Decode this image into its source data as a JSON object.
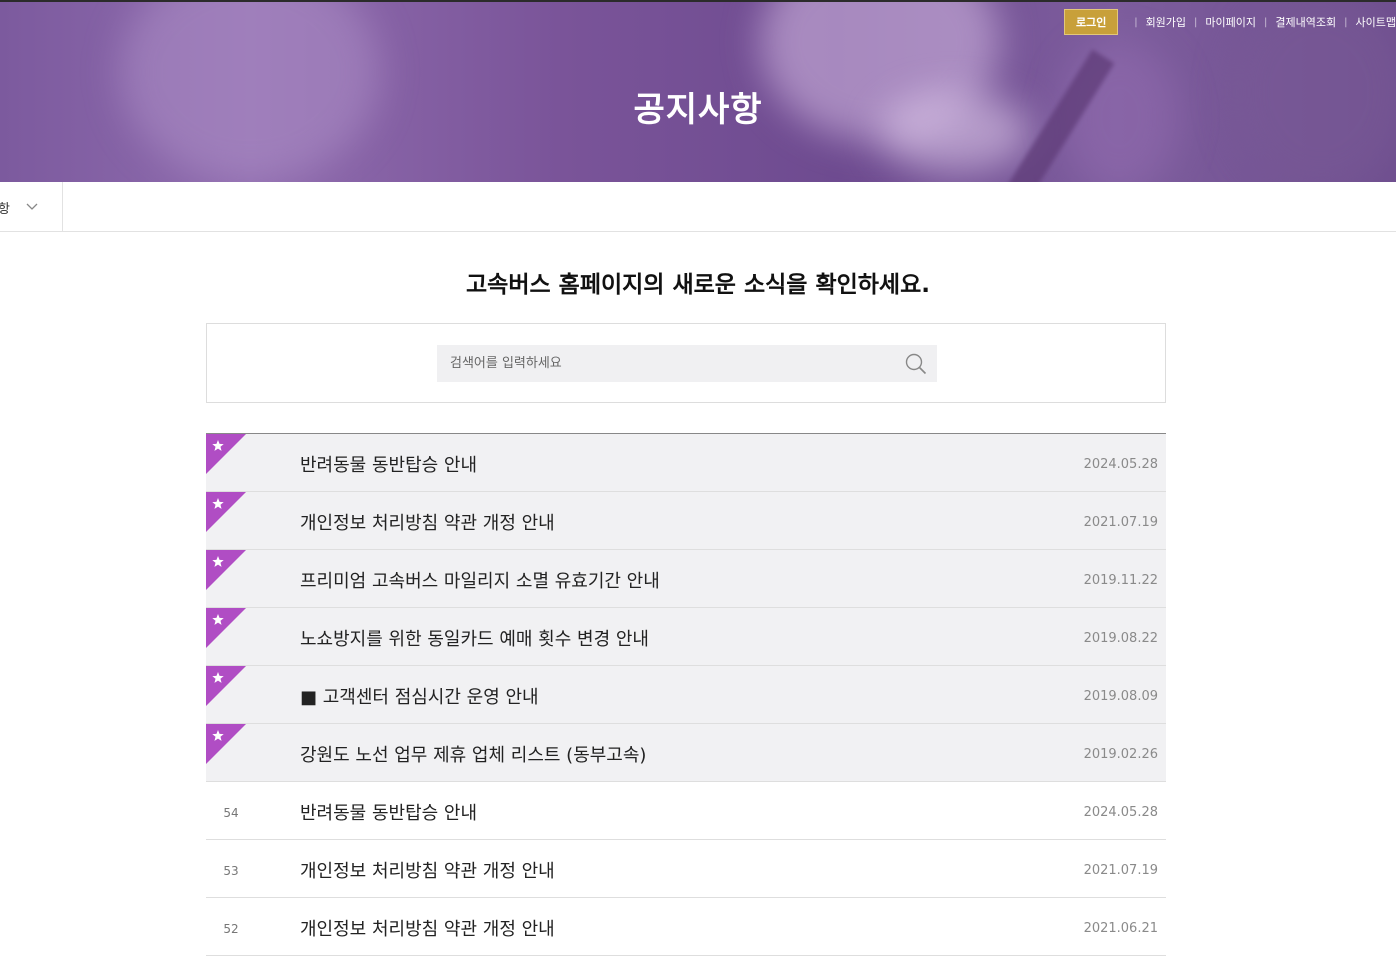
{
  "header": {
    "title": "공지사항",
    "util": {
      "login": "로그인",
      "links": [
        "회원가입",
        "마이페이지",
        "결제내역조회",
        "사이트맵"
      ]
    }
  },
  "subnav": {
    "current": "사항"
  },
  "main": {
    "headline": "고속버스 홈페이지의 새로운 소식을 확인하세요.",
    "search": {
      "placeholder": "검색어를 입력하세요",
      "value": ""
    },
    "notices": [
      {
        "pinned": true,
        "num": "",
        "title": "반려동물 동반탑승 안내",
        "date": "2024.05.28"
      },
      {
        "pinned": true,
        "num": "",
        "title": "개인정보 처리방침 약관 개정 안내",
        "date": "2021.07.19"
      },
      {
        "pinned": true,
        "num": "",
        "title": "프리미엄 고속버스 마일리지 소멸 유효기간 안내",
        "date": "2019.11.22"
      },
      {
        "pinned": true,
        "num": "",
        "title": "노쇼방지를 위한 동일카드 예매 횟수 변경 안내",
        "date": "2019.08.22"
      },
      {
        "pinned": true,
        "num": "",
        "title": "■ 고객센터 점심시간 운영 안내",
        "date": "2019.08.09"
      },
      {
        "pinned": true,
        "num": "",
        "title": "강원도 노선 업무 제휴 업체 리스트 (동부고속)",
        "date": "2019.02.26"
      },
      {
        "pinned": false,
        "num": "54",
        "title": "반려동물 동반탑승 안내",
        "date": "2024.05.28"
      },
      {
        "pinned": false,
        "num": "53",
        "title": "개인정보 처리방침 약관 개정 안내",
        "date": "2021.07.19"
      },
      {
        "pinned": false,
        "num": "52",
        "title": "개인정보 처리방침 약관 개정 안내",
        "date": "2021.06.21"
      }
    ]
  },
  "colors": {
    "accent_gold": "#c8a03a",
    "pin_flag": "#b04dc4",
    "hero_purple": "#7a5499"
  },
  "icons": {
    "search": "search-icon",
    "pin": "star-icon",
    "dropdown": "chevron-down-icon"
  }
}
